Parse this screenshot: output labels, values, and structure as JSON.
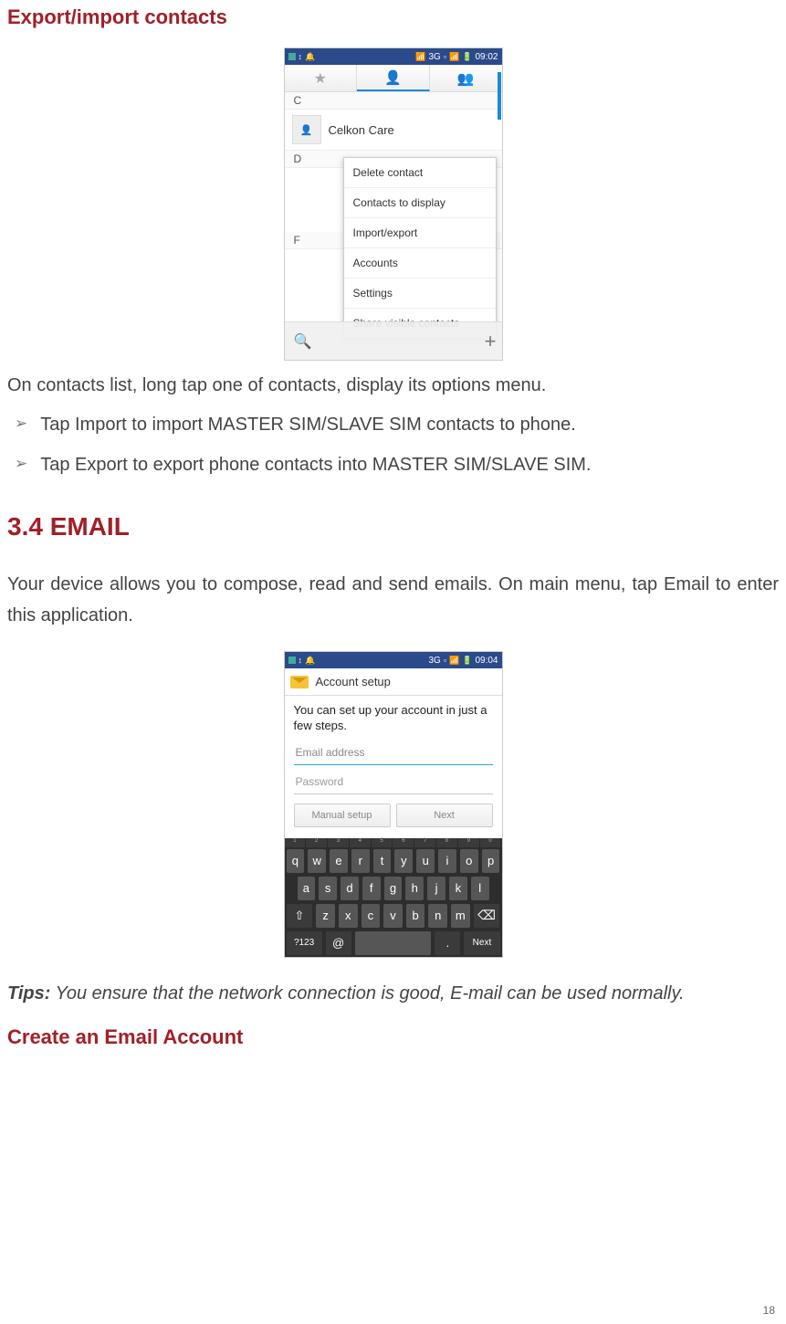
{
  "headings": {
    "h1": "Export/import contacts",
    "h2": "3.4 EMAIL",
    "h3": "Create an Email Account"
  },
  "body": {
    "contacts_intro": "On contacts list, long tap one of contacts, display its options menu.",
    "bullets": [
      "Tap Import to import MASTER SIM/SLAVE SIM contacts to phone.",
      "Tap Export to export phone contacts into MASTER SIM/SLAVE SIM."
    ],
    "email_intro": "Your device allows you to compose, read and send emails. On main menu, tap Email to enter this application.",
    "tips_label": "Tips:",
    "tips_body": " You ensure that the network connection is good, E-mail can be used normally."
  },
  "page_number": "18",
  "screenshot1": {
    "status_time": "09:02",
    "status_3g": "3G",
    "sections": {
      "c": "C",
      "d": "D",
      "f": "F"
    },
    "contact_name": "Celkon Care",
    "menu": [
      "Delete contact",
      "Contacts to display",
      "Import/export",
      "Accounts",
      "Settings",
      "Share visible contacts"
    ]
  },
  "screenshot2": {
    "status_time": "09:04",
    "status_3g": "3G",
    "title": "Account setup",
    "message": "You can set up your account in just a few steps.",
    "email_placeholder": "Email address",
    "password_placeholder": "Password",
    "buttons": {
      "manual": "Manual setup",
      "next": "Next"
    },
    "keyboard": {
      "nums": [
        "1",
        "2",
        "3",
        "4",
        "5",
        "6",
        "7",
        "8",
        "9",
        "0"
      ],
      "row1": [
        "q",
        "w",
        "e",
        "r",
        "t",
        "y",
        "u",
        "i",
        "o",
        "p"
      ],
      "row2": [
        "a",
        "s",
        "d",
        "f",
        "g",
        "h",
        "j",
        "k",
        "l"
      ],
      "row3_shift": "⇧",
      "row3": [
        "z",
        "x",
        "c",
        "v",
        "b",
        "n",
        "m"
      ],
      "row3_bksp": "⌫",
      "row4_sym": "?123",
      "row4_at": "@",
      "row4_dot": ".",
      "row4_next": "Next"
    }
  }
}
